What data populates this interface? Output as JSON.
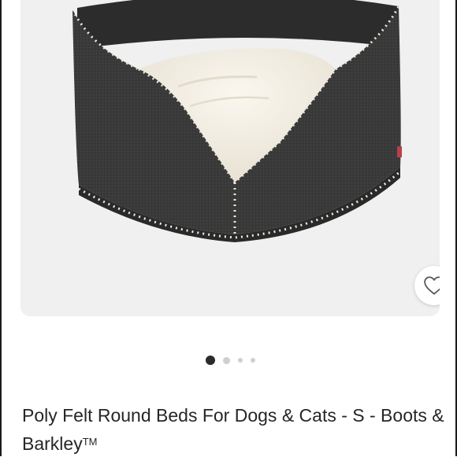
{
  "product": {
    "title": "Poly Felt Round Beds For Dogs & Cats - S - Boots & Barkley",
    "trademark": "TM"
  },
  "carousel": {
    "total_dots": 4,
    "active_index": 1
  },
  "wishlist": {
    "icon": "heart-outline-icon"
  },
  "colors": {
    "image_background": "#f0f0f0",
    "felt": "#3a3a3a",
    "sherpa": "#f4f0e6",
    "active_dot": "#2b2b2b",
    "inactive_dot": "#cfcfcf"
  }
}
